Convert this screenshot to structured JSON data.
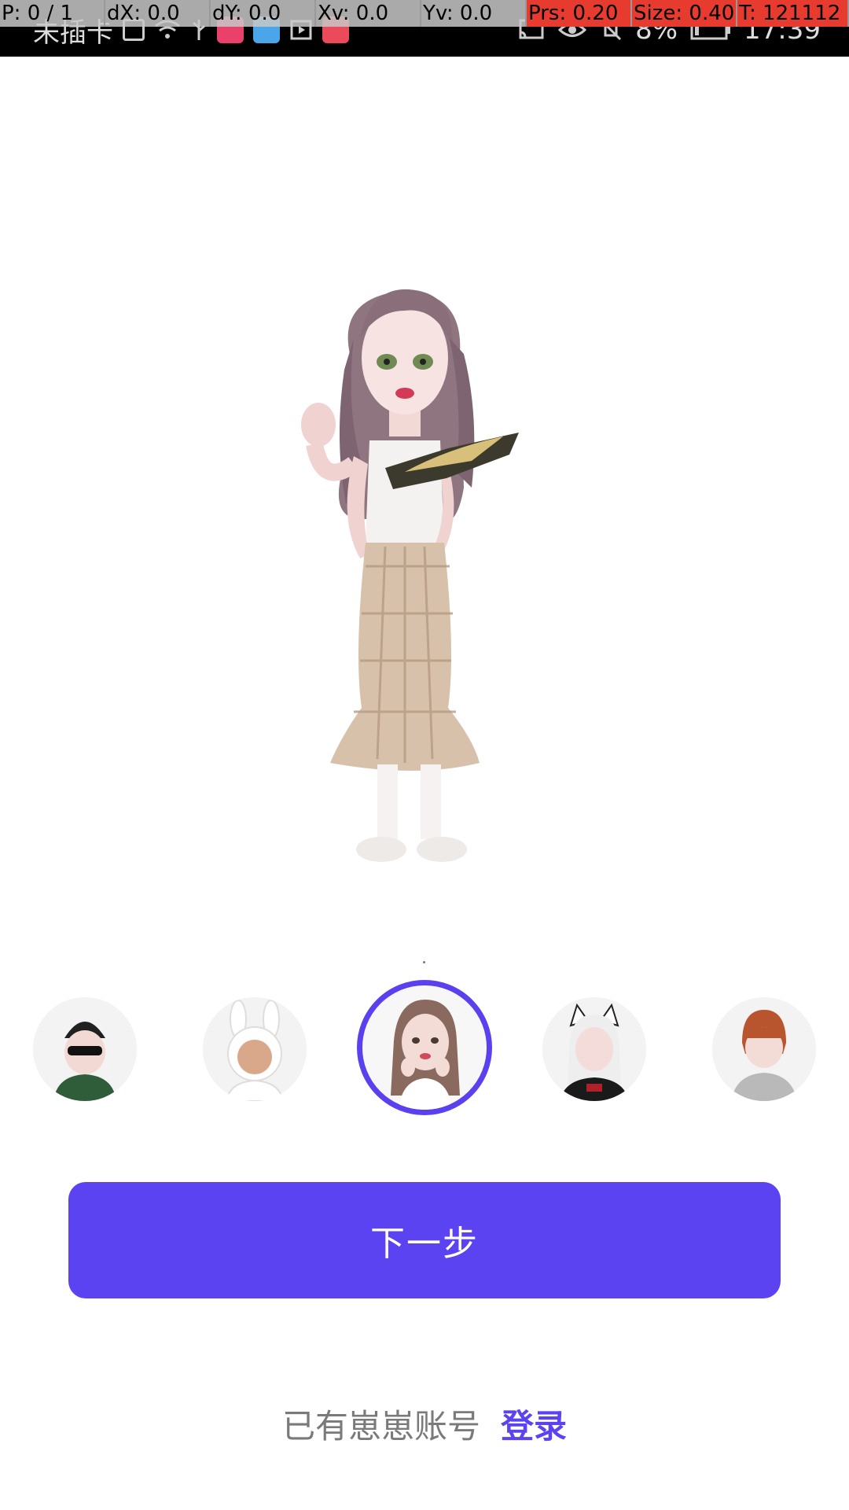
{
  "status_bar": {
    "carrier": "未插卡",
    "battery": "8%",
    "time": "17:39",
    "icons": [
      "sim-icon",
      "wifi-icon",
      "usb-icon",
      "app-icon-red",
      "app-icon-blue",
      "media-icon",
      "app-icon-red-2",
      "cast-icon",
      "eye-icon",
      "mute-icon",
      "battery-icon"
    ]
  },
  "debug_overlay": {
    "p": "P: 0 / 1",
    "dx": "dX: 0.0",
    "dy": "dY: 0.0",
    "xv": "Xv: 0.0",
    "yv": "Yv: 0.0",
    "prs": "Prs: 0.20",
    "size": "Size: 0.40",
    "t": "T: 121112"
  },
  "colors": {
    "accent": "#5b43f1",
    "muted_text": "#7a7a7a"
  },
  "avatars": [
    {
      "name": "avatar-sunglasses",
      "selected": false
    },
    {
      "name": "avatar-bunny-hood",
      "selected": false
    },
    {
      "name": "avatar-long-hair-girl",
      "selected": true
    },
    {
      "name": "avatar-cat-ears",
      "selected": false
    },
    {
      "name": "avatar-short-hair",
      "selected": false
    }
  ],
  "buttons": {
    "next": "下一步"
  },
  "footer": {
    "prompt": "已有崽崽账号",
    "login": "登录"
  }
}
